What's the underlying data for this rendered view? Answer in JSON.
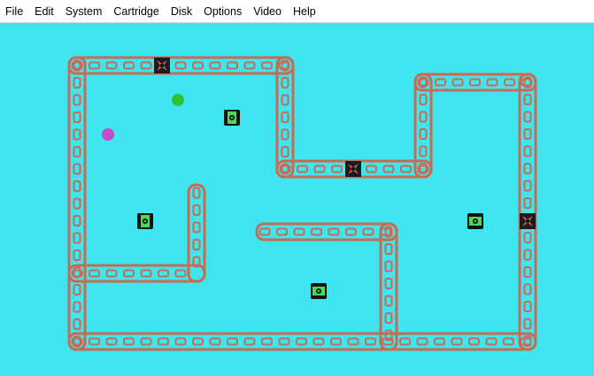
{
  "menu": {
    "items": [
      "File",
      "Edit",
      "System",
      "Cartridge",
      "Disk",
      "Options",
      "Video",
      "Help"
    ]
  },
  "colors": {
    "background": "#40e6ef",
    "track": "#c96a52",
    "gate_bg": "#1b1b1b",
    "gate_mark": "#e0645c",
    "tank": "#4dd65a",
    "tank_outline": "#101010",
    "ball_green": "#2cc23c",
    "ball_magenta": "#c24fc9"
  },
  "icons": {
    "gate": "gate-icon",
    "tank": "tank-icon",
    "ball": "ball-icon"
  }
}
